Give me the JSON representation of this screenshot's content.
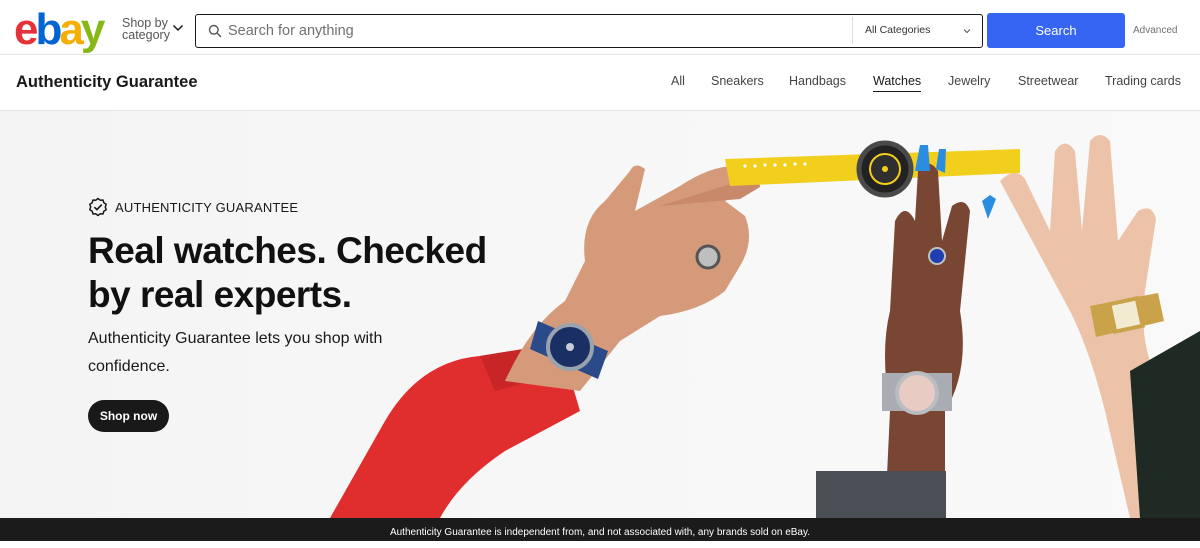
{
  "header": {
    "logo": {
      "e": "e",
      "b": "b",
      "a": "a",
      "y": "y"
    },
    "shop_by_line1": "Shop by",
    "shop_by_line2": "category",
    "search_placeholder": "Search for anything",
    "category_selected": "All Categories",
    "search_button": "Search",
    "advanced_link": "Advanced"
  },
  "subnav": {
    "title": "Authenticity Guarantee",
    "links": [
      {
        "label": "All",
        "active": false
      },
      {
        "label": "Sneakers",
        "active": false
      },
      {
        "label": "Handbags",
        "active": false
      },
      {
        "label": "Watches",
        "active": true
      },
      {
        "label": "Jewelry",
        "active": false
      },
      {
        "label": "Streetwear",
        "active": false
      },
      {
        "label": "Trading cards",
        "active": false
      }
    ]
  },
  "hero": {
    "badge_text": "AUTHENTICITY GUARANTEE",
    "heading_line1": "Real watches. Checked",
    "heading_line2": "by real experts.",
    "subtext": "Authenticity Guarantee lets you shop with confidence.",
    "cta": "Shop now"
  },
  "footer": {
    "disclaimer": "Authenticity Guarantee is independent from, and not associated with, any brands sold on eBay."
  },
  "colors": {
    "accent_blue": "#3665f3",
    "logo_red": "#e53238",
    "logo_blue": "#0064d2",
    "logo_yellow": "#f5af02",
    "logo_green": "#86b817",
    "strap_yellow": "#f2cf1d",
    "sleeve_red": "#e02d2d"
  }
}
